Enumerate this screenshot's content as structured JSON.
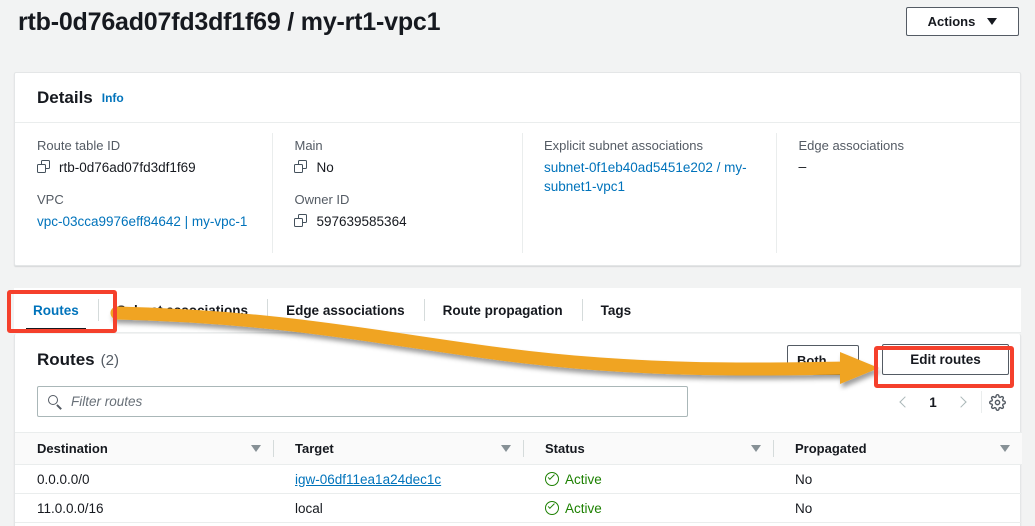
{
  "header": {
    "title": "rtb-0d76ad07fd3df1f69 / my-rt1-vpc1",
    "actions_label": "Actions"
  },
  "details": {
    "heading": "Details",
    "info_label": "Info",
    "fields": {
      "route_table_id": {
        "label": "Route table ID",
        "value": "rtb-0d76ad07fd3df1f69"
      },
      "vpc": {
        "label": "VPC",
        "value": "vpc-03cca9976eff84642 | my-vpc-1"
      },
      "main": {
        "label": "Main",
        "value": "No"
      },
      "owner_id": {
        "label": "Owner ID",
        "value": "597639585364"
      },
      "explicit_subnet_associations": {
        "label": "Explicit subnet associations",
        "value": "subnet-0f1eb40ad5451e202 / my-subnet1-vpc1"
      },
      "edge_associations": {
        "label": "Edge associations",
        "value": "–"
      }
    }
  },
  "tabs": [
    {
      "label": "Routes",
      "active": true
    },
    {
      "label": "Subnet associations",
      "active": false
    },
    {
      "label": "Edge associations",
      "active": false
    },
    {
      "label": "Route propagation",
      "active": false
    },
    {
      "label": "Tags",
      "active": false
    }
  ],
  "routes_panel": {
    "title": "Routes",
    "count": "(2)",
    "filter_placeholder": "Filter routes",
    "both_select_value": "Both",
    "edit_routes_label": "Edit routes",
    "page_number": "1",
    "columns": [
      "Destination",
      "Target",
      "Status",
      "Propagated"
    ],
    "rows": [
      {
        "destination": "0.0.0.0/0",
        "target": "igw-06df11ea1a24dec1c",
        "target_is_link": true,
        "status": "Active",
        "propagated": "No"
      },
      {
        "destination": "11.0.0.0/16",
        "target": "local",
        "target_is_link": false,
        "status": "Active",
        "propagated": "No"
      }
    ]
  },
  "annotations": {
    "highlight_color": "#f5402c",
    "arrow_color": "#f0a423",
    "arrow_from": "routes-tab",
    "arrow_to": "edit-routes-button"
  }
}
